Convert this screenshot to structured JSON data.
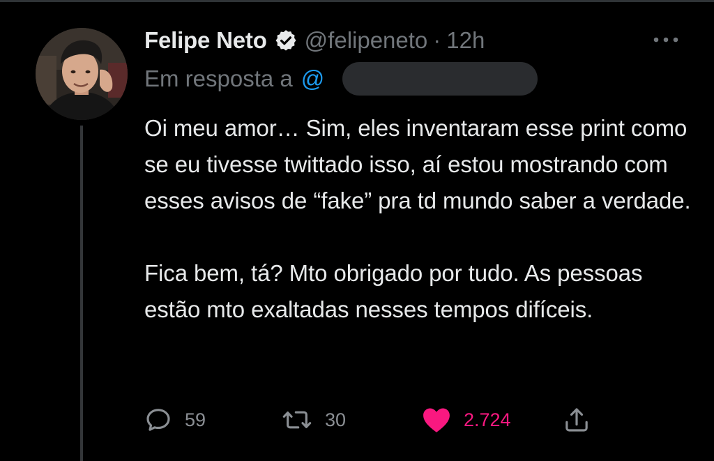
{
  "tweet": {
    "display_name": "Felipe Neto",
    "handle": "@felipeneto",
    "separator": "·",
    "time": "12h",
    "reply_to_label": "Em resposta a",
    "reply_to_handle_visible": "@",
    "paragraph_1": "Oi meu amor… Sim, eles inventaram esse print como se eu tivesse twittado isso, aí estou mostrando com esses avisos de “fake” pra td mundo saber a verdade.",
    "paragraph_2": "Fica bem, tá? Mto obrigado por tudo. As pessoas estão mto exaltadas nesses tempos difíceis."
  },
  "actions": {
    "replies": "59",
    "retweets": "30",
    "likes": "2.724"
  },
  "icons": {
    "verified": "verified-badge-icon",
    "more": "more-dots-icon",
    "reply": "reply-bubble-icon",
    "retweet": "retweet-icon",
    "like": "heart-icon",
    "share": "share-icon"
  },
  "colors": {
    "background": "#000000",
    "text_primary": "#e7e9ea",
    "text_secondary": "#71767b",
    "link": "#1d9bf0",
    "like_active": "#f91880"
  }
}
